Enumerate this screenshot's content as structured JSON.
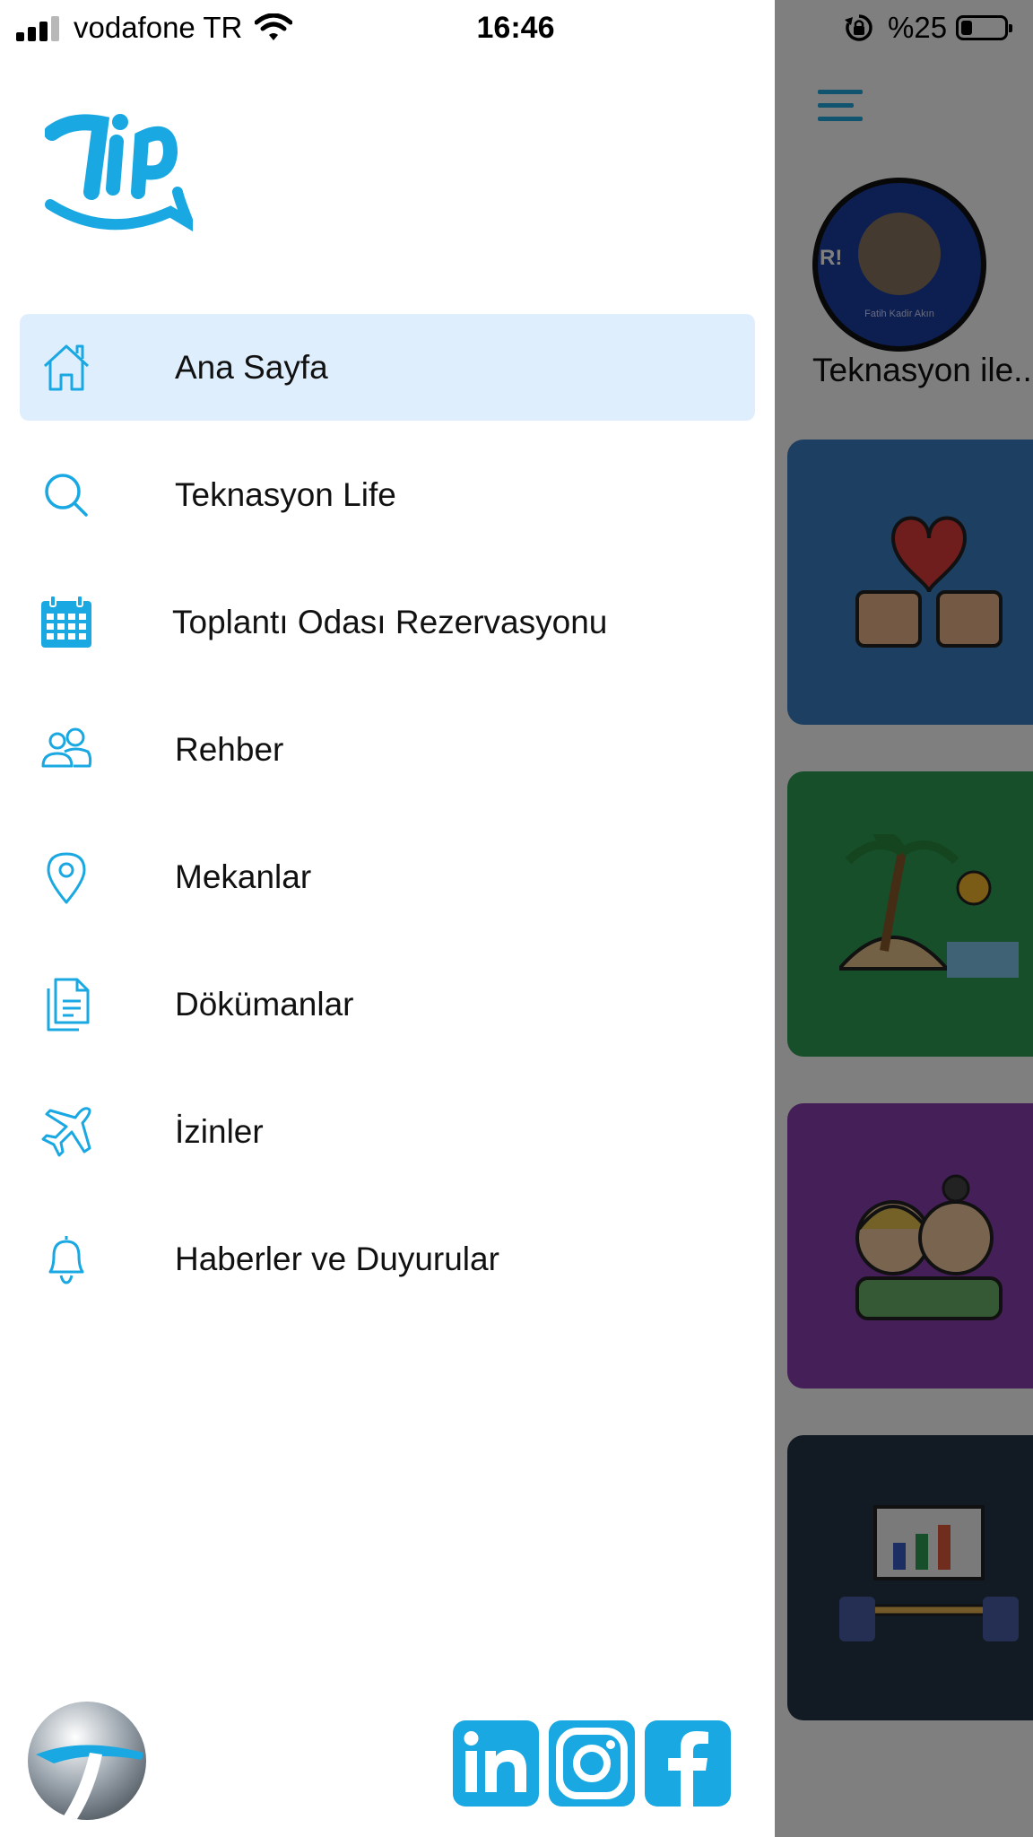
{
  "status_bar": {
    "carrier": "vodafone TR",
    "time": "16:46",
    "battery_text": "%25",
    "battery_level": 0.25
  },
  "drawer": {
    "logo_name": "tip-logo",
    "menu": [
      {
        "label": "Ana Sayfa",
        "icon": "home-icon",
        "active": true
      },
      {
        "label": "Teknasyon Life",
        "icon": "search-icon",
        "active": false
      },
      {
        "label": "Toplantı Odası Rezervasyonu",
        "icon": "calendar-icon",
        "active": false
      },
      {
        "label": "Rehber",
        "icon": "people-icon",
        "active": false
      },
      {
        "label": "Mekanlar",
        "icon": "map-pin-icon",
        "active": false
      },
      {
        "label": "Dökümanlar",
        "icon": "document-icon",
        "active": false
      },
      {
        "label": "İzinler",
        "icon": "airplane-icon",
        "active": false
      },
      {
        "label": "Haberler ve Duyurular",
        "icon": "bell-icon",
        "active": false
      }
    ],
    "footer": {
      "company_logo": "teknasyon-logo",
      "social": [
        "linkedin-icon",
        "instagram-icon",
        "facebook-icon"
      ]
    }
  },
  "background_screen": {
    "story": {
      "avatar_caption": "Fatih Kadir Akın",
      "title": "Teknasyon ile..."
    },
    "cards": [
      {
        "color": "#3a7fc4",
        "icon": "heart-thumbs-icon"
      },
      {
        "color": "#2f9e55",
        "icon": "beach-icon"
      },
      {
        "color": "#8a3fb0",
        "icon": "friends-icon"
      },
      {
        "color": "#243447",
        "icon": "meeting-icon"
      }
    ]
  },
  "colors": {
    "accent": "#1aa8e2",
    "active_bg": "#dfeefd"
  }
}
